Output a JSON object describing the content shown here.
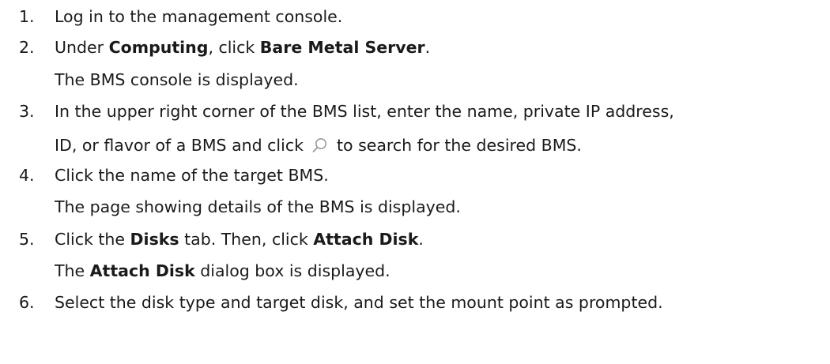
{
  "steps": [
    {
      "number": "1.",
      "parts": [
        "Log in to the management console."
      ]
    },
    {
      "number": "2.",
      "parts": [
        "Under ",
        "Computing",
        ", click ",
        "Bare Metal Server",
        "."
      ],
      "result": "The BMS console is displayed."
    },
    {
      "number": "3.",
      "line1": "In the upper right corner of the BMS list, enter the name, private IP address,",
      "line2_before": "ID, or flavor of a BMS and click",
      "line2_after": "to search for the desired BMS.",
      "icon": "search-icon"
    },
    {
      "number": "4.",
      "parts": [
        "Click the name of the target BMS."
      ],
      "result": "The page showing details of the BMS is displayed."
    },
    {
      "number": "5.",
      "parts": [
        "Click the ",
        "Disks",
        " tab. Then, click ",
        "Attach Disk",
        "."
      ],
      "result_parts": [
        "The ",
        "Attach Disk",
        " dialog box is displayed."
      ]
    },
    {
      "number": "6.",
      "parts": [
        "Select the disk type and target disk, and set the mount point as prompted."
      ]
    }
  ]
}
